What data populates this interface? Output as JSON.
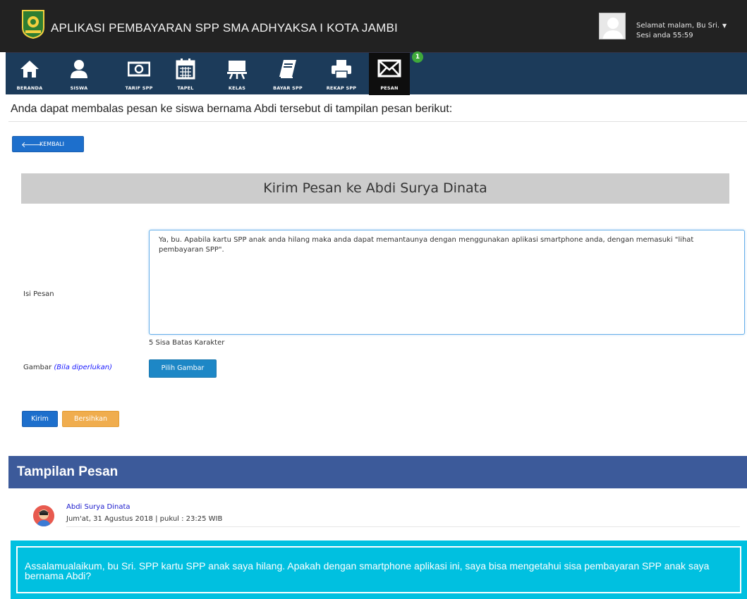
{
  "header": {
    "app_title": "APLIKASI PEMBAYARAN SPP SMA ADHYAKSA I KOTA JAMBI",
    "greeting": "Selamat malam, Bu Sri.",
    "session": "Sesi anda 55:59"
  },
  "nav": {
    "items": [
      {
        "label": "BERANDA",
        "icon": "home-icon"
      },
      {
        "label": "SISWA",
        "icon": "user-icon"
      },
      {
        "label": "TARIF SPP",
        "icon": "money-icon"
      },
      {
        "label": "TAPEL",
        "icon": "calendar-icon"
      },
      {
        "label": "KELAS",
        "icon": "classroom-icon"
      },
      {
        "label": "BAYAR SPP",
        "icon": "book-icon"
      },
      {
        "label": "REKAP SPP",
        "icon": "print-icon"
      },
      {
        "label": "PESAN",
        "icon": "envelope-icon"
      }
    ],
    "active": "PESAN",
    "badge": "1"
  },
  "intro": "Anda dapat membalas pesan ke siswa bernama Abdi tersebut di tampilan pesan berikut:",
  "back_button": "KEMBALI",
  "form": {
    "title": "Kirim Pesan ke Abdi Surya Dinata",
    "isi_label": "Isi Pesan",
    "message_value": "Ya, bu. Apabila kartu SPP anak anda hilang maka anda dapat memantaunya dengan menggunakan aplikasi smartphone anda, dengan memasuki \"lihat pembayaran SPP\".",
    "counter": "5 Sisa Batas Karakter",
    "gambar_label": "Gambar",
    "gambar_hint": "(Bila diperlukan)",
    "pilih_button": "Pilih Gambar",
    "kirim_button": "Kirim",
    "bersihkan_button": "Bersihkan"
  },
  "tampilan": {
    "heading": "Tampilan Pesan",
    "sender": "Abdi Surya Dinata",
    "date": "Jum'at, 31 Agustus 2018 | pukul : 23:25 WIB",
    "message": "Assalamualaikum, bu Sri. SPP kartu SPP anak saya hilang. Apakah dengan smartphone aplikasi ini, saya bisa mengetahui sisa pembayaran SPP anak saya bernama Abdi?"
  },
  "colors": {
    "topbar": "#222222",
    "navbar": "#1c3b5a",
    "primary": "#1d6fcc",
    "warning": "#f0ad4e",
    "section": "#3c5a9a",
    "message_box": "#00c0e0"
  }
}
